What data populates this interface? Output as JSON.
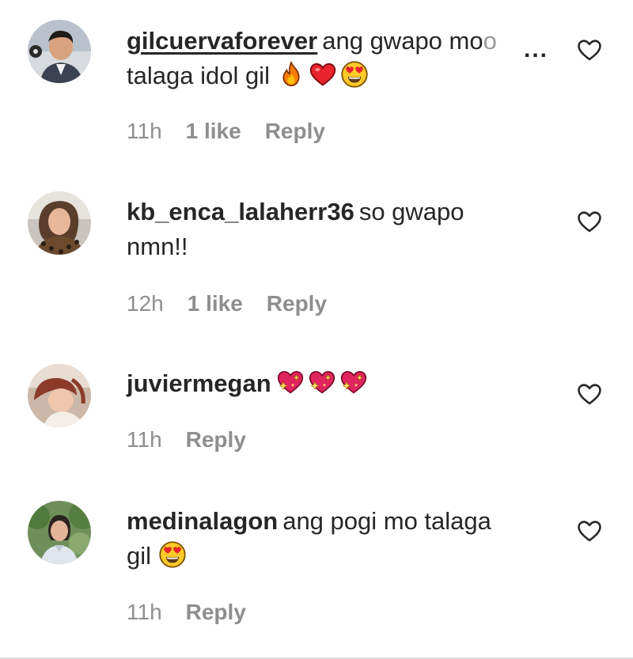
{
  "comments": [
    {
      "username": "gilcuervaforever",
      "text_line1": "ang gwapo mo",
      "text_fade": "o",
      "more": "...",
      "text_line2": "talaga idol gil",
      "emojis": [
        "fire-emoji",
        "red-heart-emoji",
        "heart-eyes-emoji"
      ],
      "time": "11h",
      "likes": "1 like",
      "reply": "Reply"
    },
    {
      "username": "kb_enca_lalaherr36",
      "text_line1": "so gwapo",
      "text_line2": "nmn!!",
      "time": "12h",
      "likes": "1 like",
      "reply": "Reply"
    },
    {
      "username": "juviermegan",
      "emojis": [
        "sparkling-heart-emoji",
        "sparkling-heart-emoji",
        "sparkling-heart-emoji"
      ],
      "time": "11h",
      "reply": "Reply"
    },
    {
      "username": "medinalagon",
      "text_line1": "ang pogi mo talaga",
      "text_line2": "gil",
      "emojis": [
        "heart-eyes-emoji"
      ],
      "time": "11h",
      "reply": "Reply"
    }
  ],
  "colors": {
    "text": "#262626",
    "meta": "#8e8e8e",
    "heart_red": "#e8232c",
    "emoji_yellow": "#ffca28"
  },
  "icons": {
    "like": "heart-outline-icon"
  }
}
